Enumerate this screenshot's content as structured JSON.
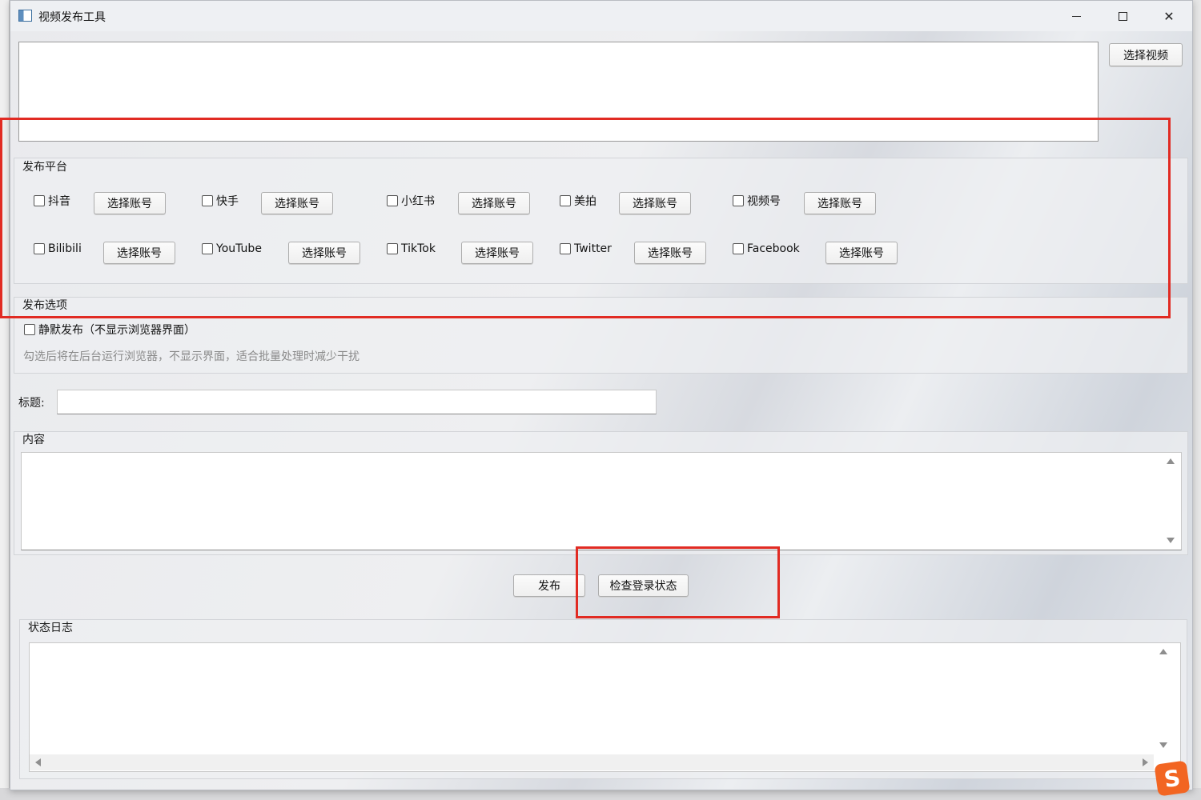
{
  "window": {
    "title": "视频发布工具",
    "controls": {
      "minimize": "minimize",
      "maximize": "maximize",
      "close": "close"
    }
  },
  "video_select": {
    "button_label": "选择视频"
  },
  "platform_group": {
    "title": "发布平台",
    "account_button_label": "选择账号",
    "platforms_row1": [
      "抖音",
      "快手",
      "小红书",
      "美拍",
      "视频号"
    ],
    "platforms_row2": [
      "Bilibili",
      "YouTube",
      "TikTok",
      "Twitter",
      "Facebook"
    ]
  },
  "options_group": {
    "title": "发布选项",
    "silent_label": "静默发布（不显示浏览器界面）",
    "hint": "勾选后将在后台运行浏览器，不显示界面，适合批量处理时减少干扰"
  },
  "title_field": {
    "label": "标题:",
    "value": ""
  },
  "content_group": {
    "title": "内容",
    "value": ""
  },
  "actions": {
    "publish_label": "发布",
    "check_login_label": "检查登录状态"
  },
  "log_group": {
    "title": "状态日志",
    "value": ""
  },
  "annotation": {
    "highlight_color": "#e12b23"
  },
  "icons": [
    "app-icon",
    "minimize-icon",
    "maximize-icon",
    "close-icon",
    "sogou-ime-icon"
  ]
}
